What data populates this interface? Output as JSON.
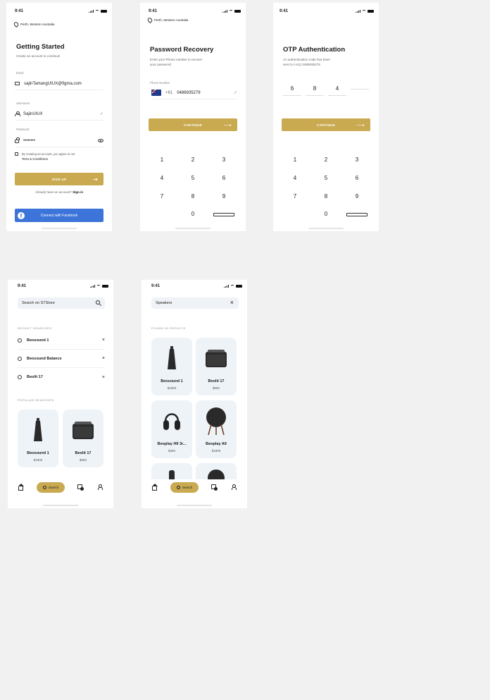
{
  "status_time": "9:41",
  "location": "Perth, Western Australia",
  "signup": {
    "title": "Getting Started",
    "subtitle": "Create an account to continue!",
    "email_label": "Email",
    "email_value": "sajinTamangUIUX@figma.com",
    "username_label": "Username",
    "username_value": "SajinUIUX",
    "password_label": "Password",
    "password_value": "••••••••",
    "terms_text": "By creating an account, you agree to our",
    "terms_link": "Term & Conditions",
    "signup_button": "SIGN UP",
    "have_account": "Already have an account?",
    "signin_link": "Sign in",
    "facebook_button": "Connect with Facebook"
  },
  "password_recovery": {
    "title": "Password Recovery",
    "subtitle_1": "Enter your Phone number to recover",
    "subtitle_2": "your password",
    "phone_label": "Phone Number",
    "country_code": "+61",
    "phone_value": "0486935279",
    "continue_button": "CONTINUE"
  },
  "otp": {
    "title": "OTP Authentication",
    "subtitle_1": "An authentication code has been",
    "subtitle_2": "sent to (+61) 0486935279",
    "digits": [
      "6",
      "8",
      "4",
      ""
    ],
    "continue_button": "CONTINUE"
  },
  "keypad": [
    "1",
    "2",
    "3",
    "4",
    "5",
    "6",
    "7",
    "8",
    "9",
    "0"
  ],
  "search_home": {
    "placeholder": "Search on STStore",
    "recent_title": "RECENT SEARCHES",
    "recent": [
      "Beosound 1",
      "Beosound Balance",
      "Beolit 17"
    ],
    "popular_title": "POPULAR SEARCHES",
    "popular": [
      {
        "name": "Beosound 1",
        "price": "$1800"
      },
      {
        "name": "Beolit 17",
        "price": "$550"
      }
    ],
    "nav_search_label": "Search"
  },
  "search_results": {
    "query": "Speakers",
    "found_text": "FOUND 50 RESULTS",
    "results": [
      {
        "name": "Beosound 1",
        "price": "$1800"
      },
      {
        "name": "Beolit 17",
        "price": "$550"
      },
      {
        "name": "Beoplay H9 3r...",
        "price": "$350"
      },
      {
        "name": "Beoplay A9",
        "price": "$1800"
      }
    ],
    "nav_search_label": "Search"
  },
  "colors": {
    "accent": "#c9aa51",
    "facebook": "#3d74d9",
    "card_bg": "#eef3f8",
    "background": "#f1f1f1"
  }
}
